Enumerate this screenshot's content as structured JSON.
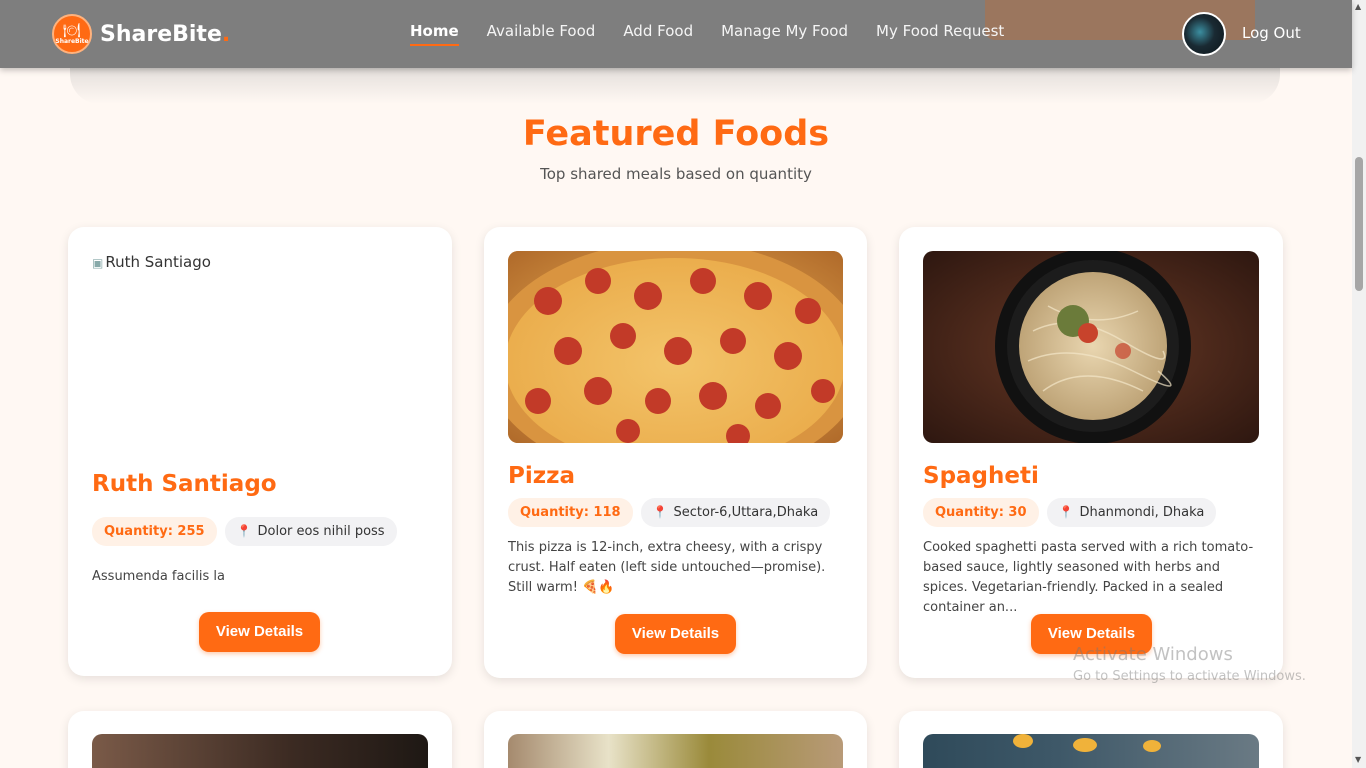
{
  "navbar": {
    "brand_name": "ShareBite",
    "brand_dot": ".",
    "logo_text": "ShareBite",
    "links": [
      {
        "label": "Home",
        "active": true
      },
      {
        "label": "Available Food",
        "active": false
      },
      {
        "label": "Add Food",
        "active": false
      },
      {
        "label": "Manage My Food",
        "active": false
      },
      {
        "label": "My Food Request",
        "active": false
      }
    ],
    "logout_label": "Log Out"
  },
  "section": {
    "title": "Featured Foods",
    "subtitle": "Top shared meals based on quantity"
  },
  "cards": [
    {
      "image_alt": "Ruth Santiago",
      "title": "Ruth Santiago",
      "quantity": "Quantity: 255",
      "location": "Dolor eos nihil poss",
      "description": "Assumenda facilis la",
      "button_label": "View Details"
    },
    {
      "image_alt": "Pizza",
      "title": "Pizza",
      "quantity": "Quantity: 118",
      "location": "Sector-6,Uttara,Dhaka",
      "description": "This pizza is 12-inch, extra cheesy, with a crispy crust. Half eaten (left side untouched—promise). Still warm! 🍕🔥",
      "button_label": "View Details"
    },
    {
      "image_alt": "Spagheti",
      "title": "Spagheti",
      "quantity": "Quantity: 30",
      "location": "Dhanmondi, Dhaka",
      "description": "Cooked spaghetti pasta served with a rich tomato-based sauce, lightly seasoned with herbs and spices. Vegetarian-friendly. Packed in a sealed container an...",
      "button_label": "View Details"
    }
  ],
  "watermark": {
    "title": "Activate Windows",
    "subtitle": "Go to Settings to activate Windows."
  },
  "colors": {
    "accent": "#ff6a13",
    "background": "#fff8f3"
  }
}
